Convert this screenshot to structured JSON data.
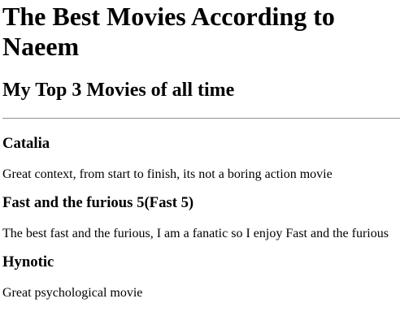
{
  "page": {
    "title": "The Best Movies According to Naeem",
    "subtitle": "My Top 3 Movies of all time"
  },
  "movies": [
    {
      "name": "Catalia",
      "description": "Great context, from start to finish, its not a boring action movie"
    },
    {
      "name": "Fast and the furious 5(Fast 5)",
      "description": "The best fast and the furious, I am a fanatic so I enjoy Fast and the furious"
    },
    {
      "name": "Hynotic",
      "description": "Great psychological movie"
    }
  ]
}
